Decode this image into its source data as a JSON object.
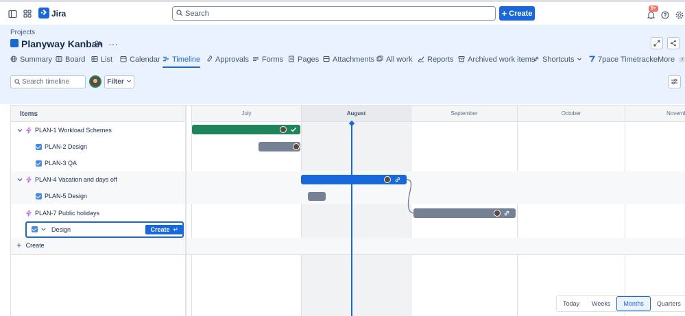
{
  "app": {
    "name": "Jira"
  },
  "search": {
    "placeholder": "Search"
  },
  "topbar": {
    "create_label": "Create",
    "notification_count": "9+"
  },
  "breadcrumb": "Projects",
  "project": {
    "title": "Planyway Kanban"
  },
  "tabs": [
    {
      "label": "Summary",
      "icon": "globe-icon"
    },
    {
      "label": "Board",
      "icon": "board-icon"
    },
    {
      "label": "List",
      "icon": "list-icon"
    },
    {
      "label": "Calendar",
      "icon": "calendar-icon"
    },
    {
      "label": "Timeline",
      "icon": "timeline-icon",
      "active": true
    },
    {
      "label": "Approvals",
      "icon": "approvals-icon"
    },
    {
      "label": "Forms",
      "icon": "forms-icon"
    },
    {
      "label": "Pages",
      "icon": "pages-icon"
    },
    {
      "label": "Attachments",
      "icon": "attachments-icon"
    },
    {
      "label": "All work",
      "icon": "all-work-icon"
    },
    {
      "label": "Reports",
      "icon": "reports-icon"
    },
    {
      "label": "Archived work items",
      "icon": "archive-icon"
    },
    {
      "label": "Shortcuts",
      "icon": "link-icon"
    },
    {
      "label": "7pace Timetracker",
      "icon": "timetracker-icon"
    },
    {
      "label": "More",
      "icon": "more-icon",
      "count": "7"
    }
  ],
  "toolbar": {
    "search_placeholder": "Search timeline",
    "filter_label": "Filter"
  },
  "timeline": {
    "items_header": "Items",
    "months": [
      "July",
      "August",
      "September",
      "October",
      "Novemb"
    ],
    "current_month": "August",
    "rows": [
      {
        "key": "PLAN-1",
        "title": "Workload Schemes",
        "type": "epic",
        "label": "PLAN-1 Workload Schemes"
      },
      {
        "key": "PLAN-2",
        "title": "Design",
        "type": "task",
        "label": "PLAN-2 Design"
      },
      {
        "key": "PLAN-3",
        "title": "QA",
        "type": "task",
        "label": "PLAN-3 QA"
      },
      {
        "key": "PLAN-4",
        "title": "Vacation and days off",
        "type": "epic",
        "label": "PLAN-4 Vacation and days off"
      },
      {
        "key": "PLAN-5",
        "title": "Design",
        "type": "task",
        "label": "PLAN-5 Design"
      },
      {
        "key": "PLAN-7",
        "title": "Public holidays",
        "type": "epic",
        "label": "PLAN-7 Public holidays"
      }
    ],
    "new_item": {
      "value": "Design",
      "create_label": "Create"
    },
    "create_row_label": "Create",
    "zoom_options": [
      "Today",
      "Weeks",
      "Months",
      "Quarters"
    ],
    "zoom_selected": "Months"
  },
  "colors": {
    "accent": "#1868db",
    "epic_bar_done": "#1f845a",
    "task_bar": "#758195",
    "epic_icon": "#bf63f3"
  }
}
